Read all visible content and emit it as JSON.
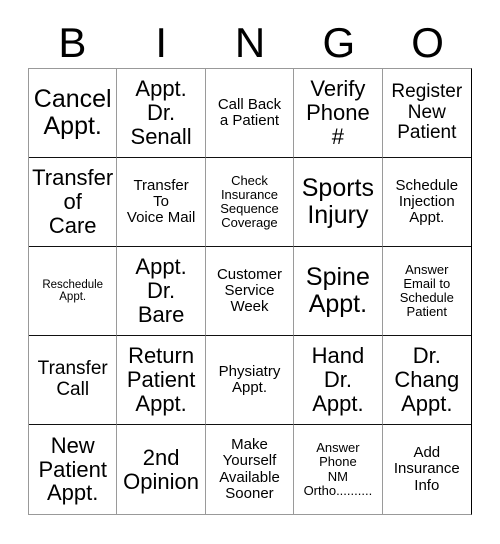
{
  "card": {
    "title": "BINGO Card",
    "header_letters": [
      "B",
      "I",
      "N",
      "G",
      "O"
    ],
    "grid_size": "5x5",
    "colors": {
      "text": "#000000",
      "background": "#ffffff",
      "grid_line": "#000000"
    },
    "columns": {
      "b": [
        "Cancel\nAppt.",
        "Transfer\nof\nCare",
        "Reschedule\nAppt.",
        "Transfer\nCall",
        "New\nPatient\nAppt."
      ],
      "i": [
        "Appt.\nDr.\nSenall",
        "Transfer\nTo\nVoice Mail",
        "Appt.\nDr.\nBare",
        "Return\nPatient\nAppt.",
        "2nd\nOpinion"
      ],
      "n": [
        "Call Back\na Patient",
        "Check\nInsurance\nSequence\nCoverage",
        "Customer\nService\nWeek",
        "Physiatry\nAppt.",
        "Make\nYourself\nAvailable\nSooner"
      ],
      "g": [
        "Verify\nPhone\n#",
        "Sports\nInjury",
        "Spine\nAppt.",
        "Hand\nDr.\nAppt.",
        "Answer\nPhone\nNM\nOrtho.........."
      ],
      "o": [
        "Register\nNew\nPatient",
        "Schedule\nInjection\nAppt.",
        "Answer\nEmail to\nSchedule\nPatient",
        "Dr.\nChang\nAppt.",
        "Add\nInsurance\nInfo"
      ]
    },
    "cells": [
      {
        "id": "b1",
        "column": "B",
        "row": 1,
        "text": "Cancel\nAppt.",
        "size": "fs-xl"
      },
      {
        "id": "i1",
        "column": "I",
        "row": 1,
        "text": "Appt.\nDr.\nSenall",
        "size": "fs-lg"
      },
      {
        "id": "n1",
        "column": "N",
        "row": 1,
        "text": "Call Back\na Patient",
        "size": "fs-sm"
      },
      {
        "id": "g1",
        "column": "G",
        "row": 1,
        "text": "Verify\nPhone\n#",
        "size": "fs-lg"
      },
      {
        "id": "o1",
        "column": "O",
        "row": 1,
        "text": "Register\nNew\nPatient",
        "size": "fs-md"
      },
      {
        "id": "b2",
        "column": "B",
        "row": 2,
        "text": "Transfer\nof\nCare",
        "size": "fs-lg"
      },
      {
        "id": "i2",
        "column": "I",
        "row": 2,
        "text": "Transfer\nTo\nVoice Mail",
        "size": "fs-sm"
      },
      {
        "id": "n2",
        "column": "N",
        "row": 2,
        "text": "Check\nInsurance\nSequence\nCoverage",
        "size": "fs-xs"
      },
      {
        "id": "g2",
        "column": "G",
        "row": 2,
        "text": "Sports\nInjury",
        "size": "fs-xl"
      },
      {
        "id": "o2",
        "column": "O",
        "row": 2,
        "text": "Schedule\nInjection\nAppt.",
        "size": "fs-sm"
      },
      {
        "id": "b3",
        "column": "B",
        "row": 3,
        "text": "Reschedule\nAppt.",
        "size": "fs-xxs"
      },
      {
        "id": "i3",
        "column": "I",
        "row": 3,
        "text": "Appt.\nDr.\nBare",
        "size": "fs-lg"
      },
      {
        "id": "n3",
        "column": "N",
        "row": 3,
        "text": "Customer\nService\nWeek",
        "size": "fs-sm"
      },
      {
        "id": "g3",
        "column": "G",
        "row": 3,
        "text": "Spine\nAppt.",
        "size": "fs-xl"
      },
      {
        "id": "o3",
        "column": "O",
        "row": 3,
        "text": "Answer\nEmail to\nSchedule\nPatient",
        "size": "fs-xs"
      },
      {
        "id": "b4",
        "column": "B",
        "row": 4,
        "text": "Transfer\nCall",
        "size": "fs-md"
      },
      {
        "id": "i4",
        "column": "I",
        "row": 4,
        "text": "Return\nPatient\nAppt.",
        "size": "fs-lg"
      },
      {
        "id": "n4",
        "column": "N",
        "row": 4,
        "text": "Physiatry\nAppt.",
        "size": "fs-sm"
      },
      {
        "id": "g4",
        "column": "G",
        "row": 4,
        "text": "Hand\nDr.\nAppt.",
        "size": "fs-lg"
      },
      {
        "id": "o4",
        "column": "O",
        "row": 4,
        "text": "Dr.\nChang\nAppt.",
        "size": "fs-lg"
      },
      {
        "id": "b5",
        "column": "B",
        "row": 5,
        "text": "New\nPatient\nAppt.",
        "size": "fs-lg"
      },
      {
        "id": "i5",
        "column": "I",
        "row": 5,
        "text": "2nd\nOpinion",
        "size": "fs-lg"
      },
      {
        "id": "n5",
        "column": "N",
        "row": 5,
        "text": "Make\nYourself\nAvailable\nSooner",
        "size": "fs-sm"
      },
      {
        "id": "g5",
        "column": "G",
        "row": 5,
        "text": "Answer\nPhone\nNM\nOrtho..........",
        "size": "fs-xs"
      },
      {
        "id": "o5",
        "column": "O",
        "row": 5,
        "text": "Add\nInsurance\nInfo",
        "size": "fs-sm"
      }
    ]
  }
}
